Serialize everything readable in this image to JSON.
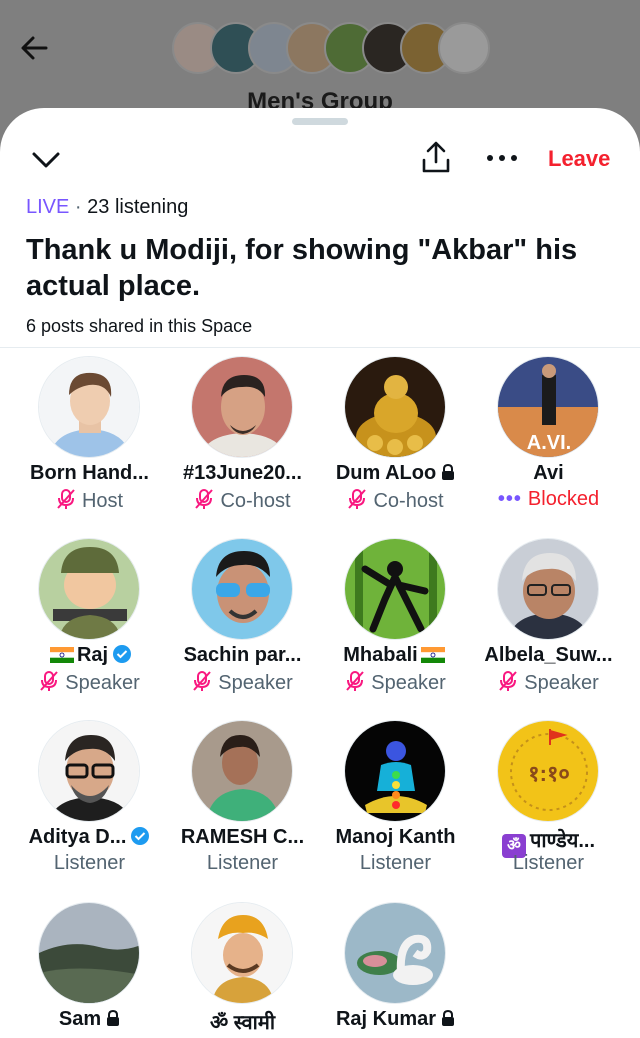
{
  "header": {
    "group_title": "Men's Group"
  },
  "sheet": {
    "leave_label": "Leave",
    "live_label": "LIVE",
    "separator": " · ",
    "listening": "23 listening",
    "title": "Thank u Modiji, for showing \"Akbar\" his actual place.",
    "posts_shared": "6 posts shared in this Space"
  },
  "participants": [
    {
      "name": "Born Hand...",
      "role": "Host"
    },
    {
      "name": "#13June20...",
      "role": "Co-host"
    },
    {
      "name": "Dum ALoo",
      "role": "Co-host"
    },
    {
      "name": "Avi",
      "role": "Blocked"
    },
    {
      "name": "Raj",
      "role": "Speaker"
    },
    {
      "name": "Sachin par...",
      "role": "Speaker"
    },
    {
      "name": "Mhabali",
      "role": "Speaker"
    },
    {
      "name": "Albela_Suw...",
      "role": "Speaker"
    },
    {
      "name": "Aditya D...",
      "role": "Listener"
    },
    {
      "name": "RAMESH C...",
      "role": "Listener"
    },
    {
      "name": "Manoj Kanth",
      "role": "Listener"
    },
    {
      "name": "पाण्डेय...",
      "role": "Listener"
    },
    {
      "name": "Sam",
      "role": ""
    },
    {
      "name": "ॐ स्वामी",
      "role": ""
    },
    {
      "name": "Raj Kumar",
      "role": ""
    }
  ],
  "avatar_text": {
    "avi": "A.VI.",
    "om_badge": "ॐ",
    "time_badge": "१:१०"
  },
  "colors": {
    "accent_live": "#7856ff",
    "danger": "#f4212e",
    "speaker_mic": "#f91880"
  }
}
